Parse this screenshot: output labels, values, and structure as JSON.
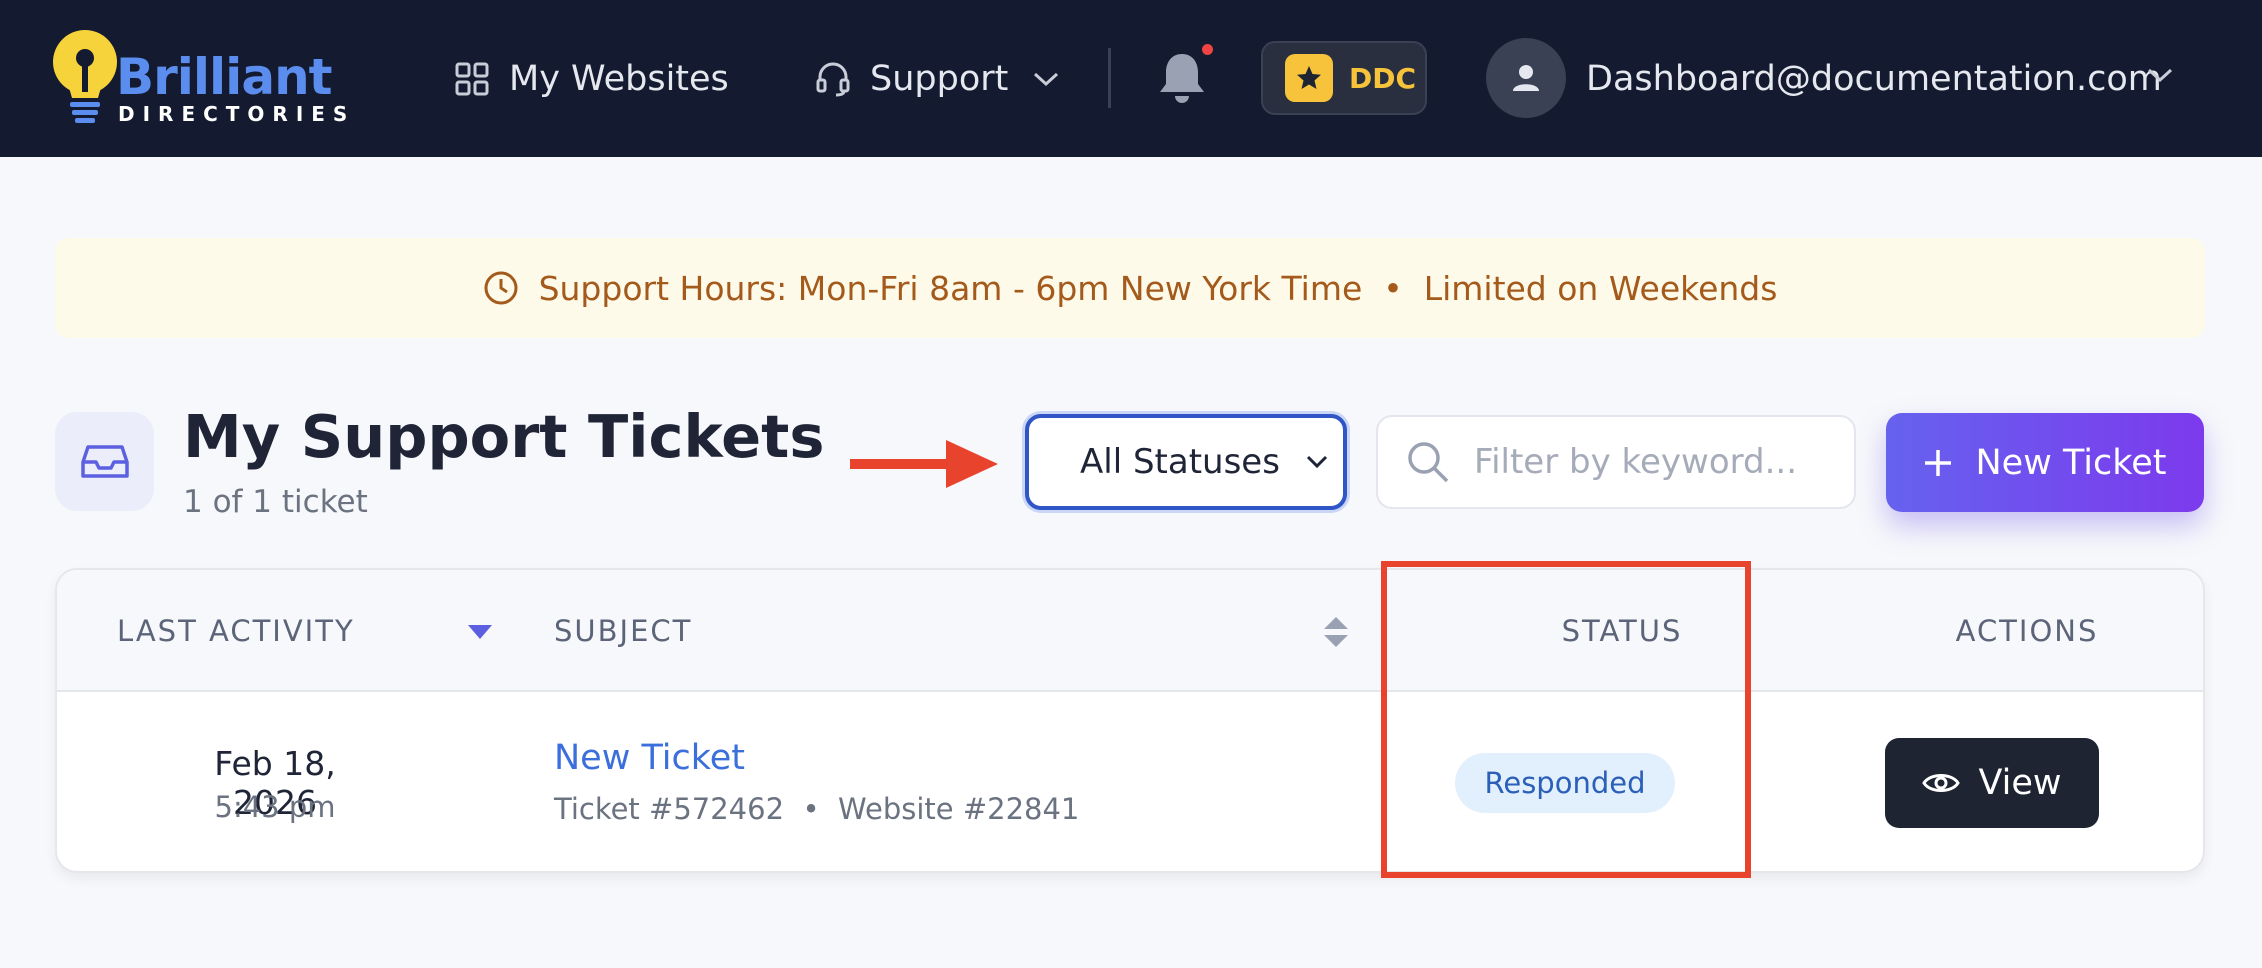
{
  "header": {
    "logo": {
      "word": "Brilliant",
      "sub": "DIRECTORIES"
    },
    "nav": {
      "websites": "My Websites",
      "support": "Support"
    },
    "badge": "DDC",
    "user_email": "Dashboard@documentation.com"
  },
  "banner": {
    "text": "Support Hours: Mon-Fri 8am - 6pm New York Time  •  Limited on Weekends"
  },
  "page": {
    "title": "My Support Tickets",
    "count": "1 of 1 ticket"
  },
  "controls": {
    "status_value": "All Statuses",
    "search_placeholder": "Filter by keyword...",
    "new_ticket": "New Ticket"
  },
  "table": {
    "columns": [
      "LAST ACTIVITY",
      "SUBJECT",
      "STATUS",
      "ACTIONS"
    ],
    "rows": [
      {
        "date": "Feb 18, 2026",
        "time": "5:43 pm",
        "subject": "New Ticket",
        "meta": "Ticket #572462  •  Website #22841",
        "status": "Responded",
        "action": "View"
      }
    ]
  },
  "colors": {
    "accent": "#6662ee",
    "nav_bg": "#141a2f",
    "annotation": "#e8432c"
  },
  "icons": [
    "bulb-icon",
    "grid-icon",
    "headset-icon",
    "chevron-down-icon",
    "bell-icon",
    "star-icon",
    "user-icon",
    "clock-icon",
    "inbox-icon",
    "arrow-right-icon",
    "search-icon",
    "plus-icon",
    "sort-down-icon",
    "sort-icon",
    "eye-icon"
  ]
}
